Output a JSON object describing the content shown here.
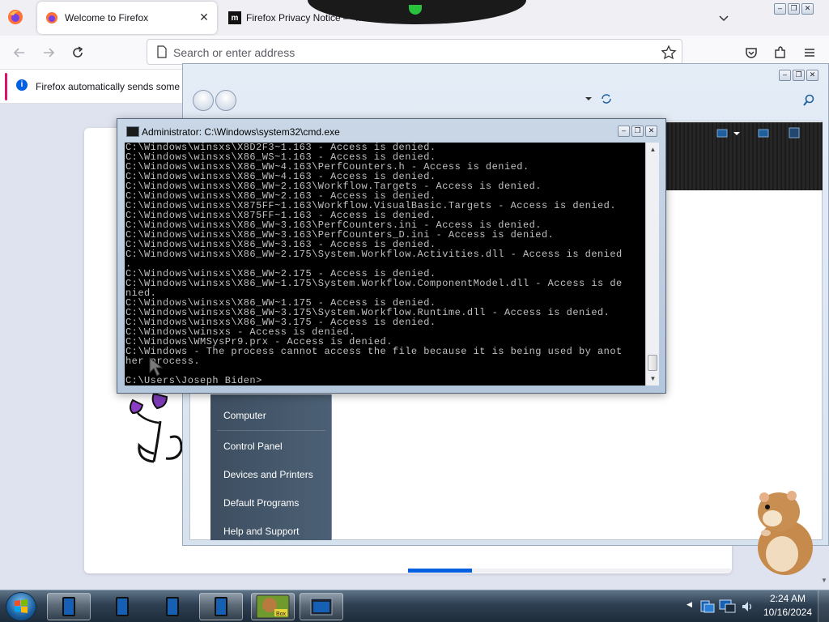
{
  "browser": {
    "tabs": [
      {
        "title": "Welcome to Firefox",
        "active": true
      },
      {
        "title": "Firefox Privacy Notice — Mo",
        "active": false
      }
    ],
    "address_placeholder": "Search or enter address",
    "notification_text": "Firefox automatically sends some c"
  },
  "explorer": {
    "start_menu_items": [
      "Computer",
      "Control Panel",
      "Devices and Printers",
      "Default Programs",
      "Help and Support"
    ]
  },
  "cmd": {
    "title": "Administrator: C:\\Windows\\system32\\cmd.exe",
    "lines": [
      "C:\\Windows\\winsxs\\X8D2F3~1.163 - Access is denied.",
      "C:\\Windows\\winsxs\\X86_WS~1.163 - Access is denied.",
      "C:\\Windows\\winsxs\\X86_WW~4.163\\PerfCounters.h - Access is denied.",
      "C:\\Windows\\winsxs\\X86_WW~4.163 - Access is denied.",
      "C:\\Windows\\winsxs\\X86_WW~2.163\\Workflow.Targets - Access is denied.",
      "C:\\Windows\\winsxs\\X86_WW~2.163 - Access is denied.",
      "C:\\Windows\\winsxs\\X875FF~1.163\\Workflow.VisualBasic.Targets - Access is denied.",
      "C:\\Windows\\winsxs\\X875FF~1.163 - Access is denied.",
      "C:\\Windows\\winsxs\\X86_WW~3.163\\PerfCounters.ini - Access is denied.",
      "C:\\Windows\\winsxs\\X86_WW~3.163\\PerfCounters_D.ini - Access is denied.",
      "C:\\Windows\\winsxs\\X86_WW~3.163 - Access is denied.",
      "C:\\Windows\\winsxs\\X86_WW~2.175\\System.Workflow.Activities.dll - Access is denied",
      ".",
      "C:\\Windows\\winsxs\\X86_WW~2.175 - Access is denied.",
      "C:\\Windows\\winsxs\\X86_WW~1.175\\System.Workflow.ComponentModel.dll - Access is de",
      "nied.",
      "C:\\Windows\\winsxs\\X86_WW~1.175 - Access is denied.",
      "C:\\Windows\\winsxs\\X86_WW~3.175\\System.Workflow.Runtime.dll - Access is denied.",
      "C:\\Windows\\winsxs\\X86_WW~3.175 - Access is denied.",
      "C:\\Windows\\winsxs - Access is denied.",
      "C:\\Windows\\WMSysPr9.prx - Access is denied.",
      "C:\\Windows - The process cannot access the file because it is being used by anot",
      "her process.",
      "",
      "C:\\Users\\Joseph Biden>"
    ]
  },
  "taskbar": {
    "time": "2:24 AM",
    "date": "10/16/2024",
    "game_icon_label": "Box"
  }
}
